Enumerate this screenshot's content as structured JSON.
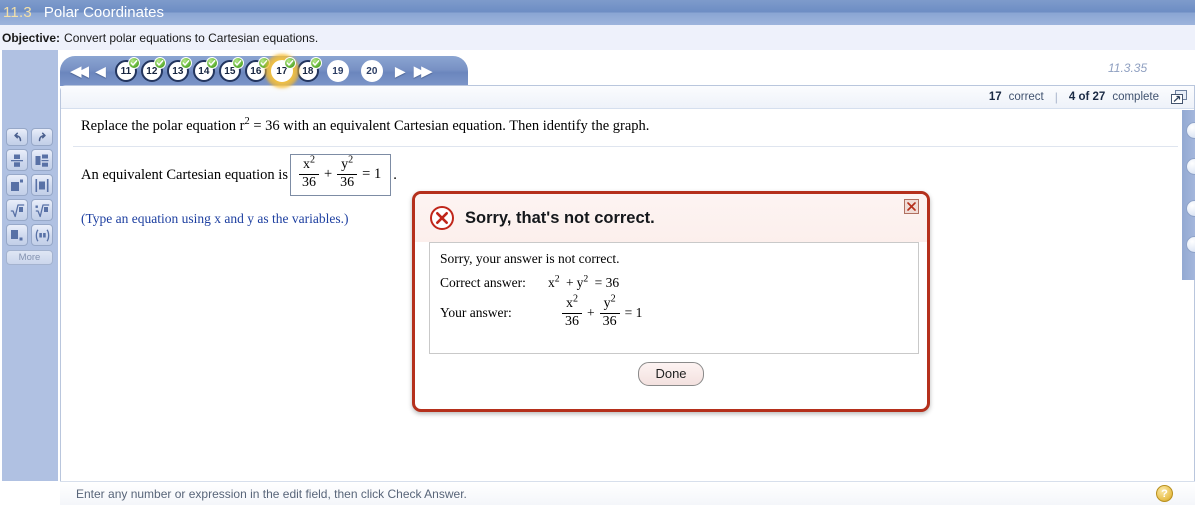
{
  "header": {
    "section_number": "11.3",
    "section_title": "Polar Coordinates",
    "objective_label": "Objective:",
    "objective_text": "Convert polar equations to Cartesian equations."
  },
  "navigation": {
    "first_icon": "◀◀",
    "prev_icon": "◀",
    "next_icon": "▶",
    "last_icon": "▶▶",
    "items": [
      {
        "label": "11",
        "completed": true,
        "current": false
      },
      {
        "label": "12",
        "completed": true,
        "current": false
      },
      {
        "label": "13",
        "completed": true,
        "current": false
      },
      {
        "label": "14",
        "completed": true,
        "current": false
      },
      {
        "label": "15",
        "completed": true,
        "current": false
      },
      {
        "label": "16",
        "completed": true,
        "current": false
      },
      {
        "label": "17",
        "completed": true,
        "current": true
      },
      {
        "label": "18",
        "completed": true,
        "current": false
      },
      {
        "label": "19",
        "completed": false,
        "current": false
      },
      {
        "label": "20",
        "completed": false,
        "current": false
      }
    ],
    "exercise_id": "11.3.35"
  },
  "status": {
    "correct_count": "17",
    "correct_word": "correct",
    "separator": "|",
    "complete_count": "4 of 27",
    "complete_word": "complete",
    "expand_icon": "expand-window-icon"
  },
  "question": {
    "text_part1": "Replace the polar equation r",
    "text_exp": "2",
    "text_part2": " = 36 with an equivalent Cartesian equation. Then identify the graph."
  },
  "answer": {
    "prompt": "An equivalent Cartesian equation is",
    "period": ".",
    "entered": {
      "num1": "x",
      "num1_exp": "2",
      "den1": "36",
      "operator": "+",
      "num2": "y",
      "num2_exp": "2",
      "den2": "36",
      "equals": "= 1"
    },
    "hint": "(Type an equation using x and y as the variables.)"
  },
  "dialog": {
    "title": "Sorry, that's not correct.",
    "error_icon": "error-circle-x-icon",
    "close_icon": "close-icon",
    "body_message": "Sorry, your answer is not correct.",
    "correct_label": "Correct answer:",
    "correct_answer": {
      "x": "x",
      "x_exp": "2",
      "plus": "+",
      "y": "y",
      "y_exp": "2",
      "equals": "= 36"
    },
    "your_label": "Your answer:",
    "your_answer": {
      "num1": "x",
      "num1_exp": "2",
      "den1": "36",
      "operator": "+",
      "num2": "y",
      "num2_exp": "2",
      "den2": "36",
      "equals": "= 1"
    },
    "done_label": "Done"
  },
  "palette": {
    "buttons": [
      {
        "name": "undo-icon",
        "glyph": "↶"
      },
      {
        "name": "redo-icon",
        "glyph": "↷"
      },
      {
        "name": "fraction-icon",
        "glyph": "fraction"
      },
      {
        "name": "mixed-number-icon",
        "glyph": "mixed"
      },
      {
        "name": "exponent-icon",
        "glyph": "exponent"
      },
      {
        "name": "absolute-value-icon",
        "glyph": "abs"
      },
      {
        "name": "square-root-icon",
        "glyph": "sqrt"
      },
      {
        "name": "nth-root-icon",
        "glyph": "nroot"
      },
      {
        "name": "subscript-icon",
        "glyph": "subscript"
      },
      {
        "name": "interval-icon",
        "glyph": "interval"
      }
    ],
    "more_label": "More"
  },
  "footer": {
    "instruction": "Enter any number or expression in the edit field, then click Check Answer.",
    "help_icon": "?",
    "help_icon_name": "help-icon"
  },
  "colors": {
    "title_bar": "#7e9bcb",
    "title_number": "#f3e0a8",
    "objective_bg": "#eef1fb",
    "nav_bar": "#7891c4",
    "nav_button_border": "#23355e",
    "check_green": "#57ab2c",
    "current_glow": "#f8c43c",
    "dialog_border": "#b5301c",
    "hint_blue": "#1d3fa0",
    "help_yellow": "#e9c14f"
  }
}
